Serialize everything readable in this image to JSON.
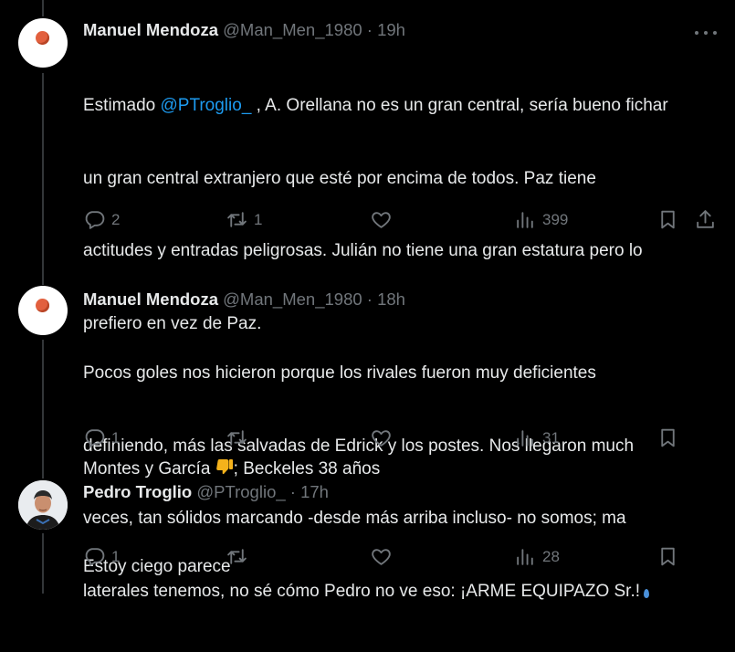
{
  "tweets": [
    {
      "name": "Manuel Mendoza",
      "handle": "@Man_Men_1980",
      "sep": "·",
      "time": "19h",
      "body_lines": [
        {
          "pre": "Estimado ",
          "mention": "@PTroglio_",
          "post": " , A. Orellana no es un gran central, sería bueno fichar"
        },
        "un gran central extranjero que esté por encima de todos. Paz tiene",
        "actitudes y entradas peligrosas. Julián no tiene una gran estatura pero lo",
        "prefiero en vez de Paz.",
        "",
        {
          "pre": "Montes y García ",
          "emoji": "thumbs-down",
          "post": "; Beckeles 38 años"
        }
      ],
      "replies": "2",
      "retweets": "1",
      "likes": "",
      "views": "399"
    },
    {
      "name": "Manuel Mendoza",
      "handle": "@Man_Men_1980",
      "sep": "·",
      "time": "18h",
      "body_lines": [
        "Pocos goles nos hicieron porque los rivales fueron muy deficientes",
        "definiendo, más las salvadas de Edrick y los postes. Nos llegaron much",
        "veces, tan sólidos marcando -desde más arriba incluso- no somos; ma",
        "laterales tenemos, no sé cómo Pedro no ve eso: ¡ARME EQUIPAZO Sr.!"
      ],
      "replies": "1",
      "retweets": "",
      "likes": "",
      "views": "31"
    },
    {
      "name": "Pedro Troglio",
      "handle": "@PTroglio_",
      "sep": "·",
      "time": "17h",
      "body_lines": [
        "Estoy ciego parece"
      ],
      "replies": "1",
      "retweets": "",
      "likes": "",
      "views": "28"
    }
  ],
  "icons": {
    "reply": "reply-icon",
    "retweet": "retweet-icon",
    "like": "heart-icon",
    "views": "analytics-icon",
    "bookmark": "bookmark-icon",
    "share": "share-icon",
    "more": "more-icon"
  },
  "colors": {
    "background": "#000000",
    "text": "#e7e9ea",
    "muted": "#71767b",
    "mention": "#1d9bf0",
    "thread_line": "#333639"
  }
}
